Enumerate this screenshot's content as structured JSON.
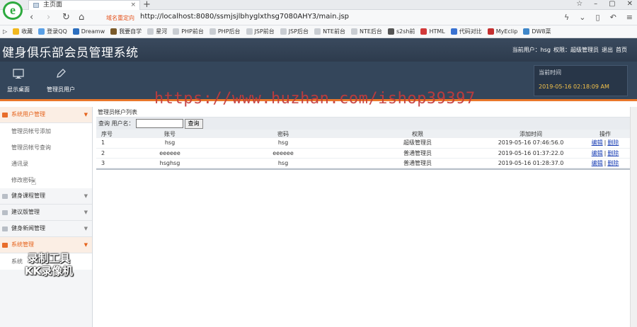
{
  "browser": {
    "tab_title": "主页面",
    "tab_close": "×",
    "new_tab": "+",
    "security_label": "域名重定向",
    "url": "http://localhost:8080/ssmjsjlbhyglxthsg7080AHY3/main.jsp",
    "bookmarks": [
      {
        "label": "收藏",
        "color": "#f1b81f"
      },
      {
        "label": "登录QQ",
        "color": "#5aa0e6"
      },
      {
        "label": "Dreamw",
        "color": "#2c6fbf"
      },
      {
        "label": "我要自学",
        "color": "#7a5a2a"
      },
      {
        "label": "星河",
        "color": "#c9cdd2"
      },
      {
        "label": "PHP前台",
        "color": "#c9cdd2"
      },
      {
        "label": "PHP后台",
        "color": "#c9cdd2"
      },
      {
        "label": "JSP前台",
        "color": "#c9cdd2"
      },
      {
        "label": "JSP后台",
        "color": "#c9cdd2"
      },
      {
        "label": "NTE前台",
        "color": "#c9cdd2"
      },
      {
        "label": "NTE后台",
        "color": "#c9cdd2"
      },
      {
        "label": "s2sh前",
        "color": "#555"
      },
      {
        "label": "HTML",
        "color": "#d23a3a"
      },
      {
        "label": "代码对比",
        "color": "#3a72d2"
      },
      {
        "label": "MyEclip",
        "color": "#c43030"
      },
      {
        "label": "DW8菜",
        "color": "#3f87c9"
      }
    ]
  },
  "header": {
    "title": "健身俱乐部会员管理系统",
    "current_user_label": "当前用户：hsg",
    "role_label": "权限：超级管理员",
    "logout": "退出",
    "home": "首页"
  },
  "toolbar": {
    "show_page": "显示桌面",
    "admin_user": "管理员用户",
    "time_label": "当前时间",
    "time_value": "2019-05-16 02:18:09 AM"
  },
  "watermark": "https://www.huzhan.com/ishop39397",
  "sidebar": {
    "groups": [
      {
        "label": "系统用户管理",
        "items": [
          "管理员帐号添加",
          "管理员帐号查询",
          "通讯录",
          "修改密码"
        ]
      },
      {
        "label": "健身课程管理"
      },
      {
        "label": "建议版管理"
      },
      {
        "label": "健身新闻管理"
      },
      {
        "label": "系统管理",
        "items": [
          "系统"
        ]
      }
    ],
    "recorder_line1": "录制工具",
    "recorder_line2": "KK录像机"
  },
  "main": {
    "panel_title": "管理员帐户列表",
    "search_label": "查询 用户名：",
    "search_value": "",
    "search_button": "查询",
    "columns": [
      "序号",
      "账号",
      "密码",
      "权限",
      "添加时间",
      "操作"
    ],
    "rows": [
      {
        "no": "1",
        "account": "hsg",
        "password": "hsg",
        "role": "超级管理员",
        "time": "2019-05-16 07:46:56.0"
      },
      {
        "no": "2",
        "account": "eeeeee",
        "password": "eeeeee",
        "role": "普通管理员",
        "time": "2019-05-16 01:37:22.0"
      },
      {
        "no": "3",
        "account": "hsghsg",
        "password": "hsg",
        "role": "普通管理员",
        "time": "2019-05-16 01:28:37.0"
      }
    ],
    "edit_label": "编辑",
    "sep": "|",
    "delete_label": "删除"
  }
}
